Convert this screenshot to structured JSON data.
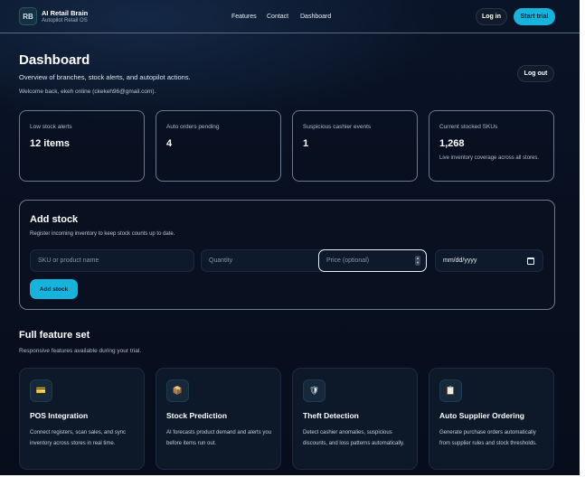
{
  "header": {
    "logo_text": "RB",
    "brand_name": "AI Retail Brain",
    "brand_sub": "Autopilot Retail OS",
    "nav": [
      "Features",
      "Contact",
      "Dashboard"
    ],
    "login_label": "Log in",
    "trial_label": "Start trial"
  },
  "dashboard": {
    "title": "Dashboard",
    "subtitle": "Overview of branches, stock alerts, and autopilot actions.",
    "welcome": "Welcome back, ekeh online (ckekeh96@gmail.com).",
    "logout_label": "Log out"
  },
  "stats": [
    {
      "label": "Low stock alerts",
      "value": "12 items",
      "note": ""
    },
    {
      "label": "Auto orders pending",
      "value": "4",
      "note": ""
    },
    {
      "label": "Suspicious cashier events",
      "value": "1",
      "note": ""
    },
    {
      "label": "Current stocked SKUs",
      "value": "1,268",
      "note": "Live inventory coverage across all stores."
    }
  ],
  "add_stock": {
    "title": "Add stock",
    "subtitle": "Register incoming inventory to keep stock counts up to date.",
    "sku_placeholder": "SKU or product name",
    "qty_placeholder": "Quantity",
    "price_placeholder": "Price (optional)",
    "date_value": "mm/dd/yyyy",
    "button_label": "Add stock"
  },
  "features": {
    "title": "Full feature set",
    "subtitle": "Responsive features available during your trial.",
    "cards": [
      {
        "icon": "pos-terminal-icon",
        "glyph": "💳",
        "title": "POS Integration",
        "desc": "Connect registers, scan sales, and sync inventory across stores in real time."
      },
      {
        "icon": "package-icon",
        "glyph": "📦",
        "title": "Stock Prediction",
        "desc": "AI forecasts product demand and alerts you before items run out."
      },
      {
        "icon": "shield-icon",
        "glyph": "🛡",
        "title": "Theft Detection",
        "desc": "Detect cashier anomalies, suspicious discounts, and loss patterns automatically."
      },
      {
        "icon": "clipboard-icon",
        "glyph": "📋",
        "title": "Auto Supplier Ordering",
        "desc": "Generate purchase orders automatically from supplier rules and stock thresholds."
      }
    ]
  },
  "colors": {
    "accent": "#18b3dc",
    "background": "#081020",
    "card_border": "#6b7a8e"
  }
}
